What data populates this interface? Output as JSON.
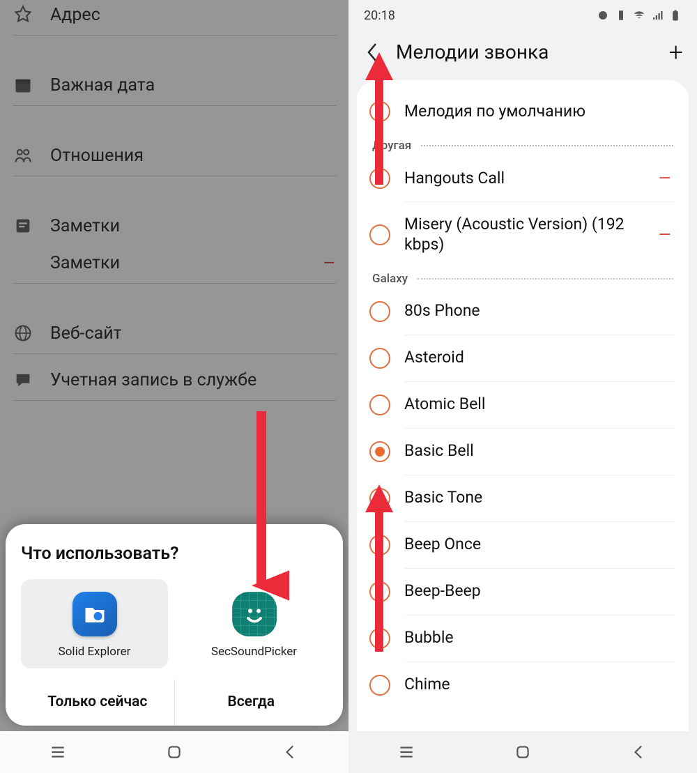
{
  "left": {
    "fields": {
      "address": "Адрес",
      "date": "Важная дата",
      "relation": "Отношения",
      "notesHeader": "Заметки",
      "notesItem": "Заметки",
      "website": "Веб-сайт",
      "account": "Учетная запись в службе"
    },
    "sheet": {
      "title": "Что использовать?",
      "app1": "Solid Explorer",
      "app2": "SecSoundPicker",
      "btnOnce": "Только сейчас",
      "btnAlways": "Всегда"
    }
  },
  "right": {
    "time": "20:18",
    "title": "Мелодии звонка",
    "topItem": "Мелодия по умолчанию",
    "sectionOther": "Другая",
    "sectionGalaxy": "Galaxy",
    "otherItems": [
      {
        "label": "Hangouts Call",
        "removable": true
      },
      {
        "label": "Misery (Acoustic Version) (192  kbps)",
        "removable": true
      }
    ],
    "galaxyItems": [
      {
        "label": "80s Phone",
        "selected": false
      },
      {
        "label": "Asteroid",
        "selected": false
      },
      {
        "label": "Atomic Bell",
        "selected": false
      },
      {
        "label": "Basic Bell",
        "selected": true
      },
      {
        "label": "Basic Tone",
        "selected": false
      },
      {
        "label": "Beep Once",
        "selected": false
      },
      {
        "label": "Beep-Beep",
        "selected": false
      },
      {
        "label": "Bubble",
        "selected": false
      },
      {
        "label": "Chime",
        "selected": false
      }
    ]
  }
}
